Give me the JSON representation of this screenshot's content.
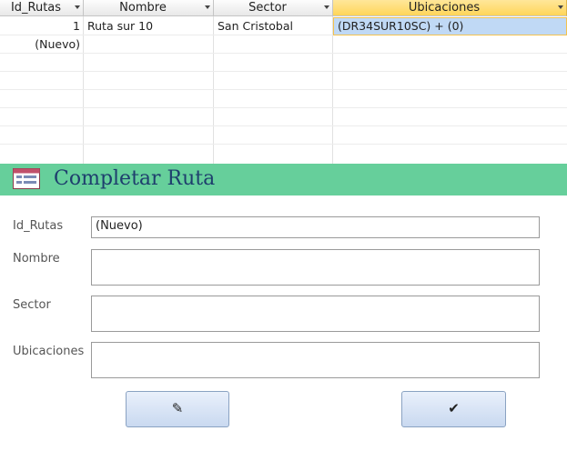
{
  "grid": {
    "columns": [
      {
        "label": "Id_Rutas"
      },
      {
        "label": "Nombre"
      },
      {
        "label": "Sector"
      },
      {
        "label": "Ubicaciones"
      }
    ],
    "rows": [
      {
        "id": "1",
        "nombre": "Ruta sur 10",
        "sector": "San Cristobal",
        "ubicaciones": "(DR34SUR10SC) + (0)"
      }
    ],
    "new_row_label": "(Nuevo)"
  },
  "form": {
    "title": "Completar Ruta",
    "fields": [
      {
        "label": "Id_Rutas",
        "value": "(Nuevo)"
      },
      {
        "label": "Nombre",
        "value": ""
      },
      {
        "label": "Sector",
        "value": ""
      },
      {
        "label": "Ubicaciones",
        "value": ""
      }
    ],
    "buttons": [
      {
        "icon": "pencil-icon",
        "glyph": "✎"
      },
      {
        "icon": "check-icon",
        "glyph": "✔"
      }
    ]
  },
  "colors": {
    "form_header": "#66cf9b",
    "title_text": "#1e3e6d",
    "selected_header": "#ffd559",
    "selected_cell": "#c0d9f5"
  }
}
